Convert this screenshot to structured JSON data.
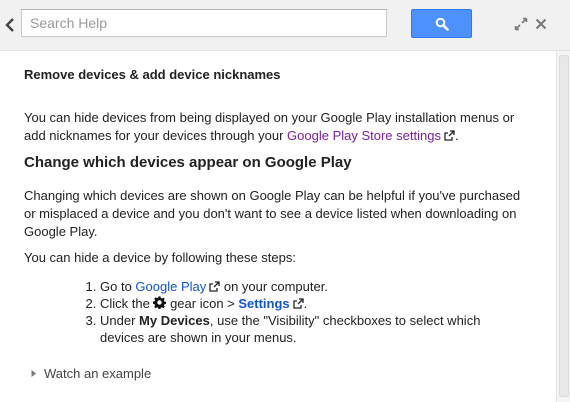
{
  "search": {
    "placeholder": "Search Help"
  },
  "article": {
    "title": "Remove devices & add device nicknames",
    "intro_text": "You can hide devices from being displayed on your Google Play installation menus or add nicknames for your devices through your ",
    "intro_link": "Google Play Store settings",
    "intro_end": ".",
    "section_heading": "Change which devices appear on Google Play",
    "section_para": "Changing which devices are shown on Google Play can be helpful if you've purchased or misplaced a device and you don't want to see a device listed when downloading on Google Play.",
    "steps_intro": "You can hide a device by following these steps:",
    "steps": {
      "s1_pre": "Go to ",
      "s1_link": "Google Play",
      "s1_post": " on your computer.",
      "s2_pre": "Click the ",
      "s2_mid": " gear icon > ",
      "s2_link": "Settings",
      "s2_post": ".",
      "s3_pre": "Under ",
      "s3_bold": "My Devices",
      "s3_post": ", use the \"Visibility\" checkboxes to select which devices are shown in your menus."
    },
    "watch_label": "Watch an example"
  },
  "colors": {
    "accent": "#4d90fe",
    "link": "#1155cc",
    "visited_link": "#7b1fa2"
  }
}
